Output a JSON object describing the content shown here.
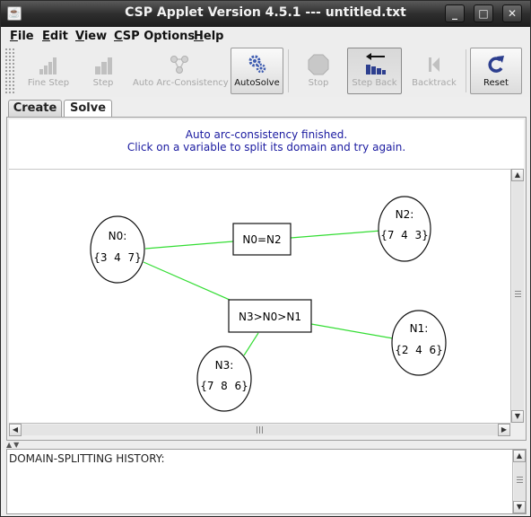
{
  "window": {
    "title": "CSP Applet Version 4.5.1 --- untitled.txt",
    "controls": {
      "minimize": "_",
      "maximize": "□",
      "close": "✕"
    }
  },
  "menu": {
    "items": [
      {
        "first": "F",
        "rest": "ile"
      },
      {
        "first": "E",
        "rest": "dit"
      },
      {
        "first": "V",
        "rest": "iew"
      },
      {
        "first": "C",
        "rest": "SP Options"
      },
      {
        "first": "H",
        "rest": "elp"
      }
    ]
  },
  "toolbar": {
    "buttons": [
      {
        "label": "Fine Step",
        "icon": "fine-step-icon",
        "enabled": false
      },
      {
        "label": "Step",
        "icon": "step-icon",
        "enabled": false
      },
      {
        "label": "Auto Arc-Consistency",
        "icon": "auto-arc-consistency-icon",
        "enabled": false
      },
      {
        "label": "AutoSolve",
        "icon": "autosolve-icon",
        "enabled": true
      },
      {
        "label": "Stop",
        "icon": "stop-icon",
        "enabled": false
      },
      {
        "label": "Step Back",
        "icon": "step-back-icon",
        "enabled": true
      },
      {
        "label": "Backtrack",
        "icon": "backtrack-icon",
        "enabled": false
      },
      {
        "label": "Reset",
        "icon": "reset-icon",
        "enabled": true
      }
    ]
  },
  "tabs": [
    {
      "label": "Create",
      "active": false
    },
    {
      "label": "Solve",
      "active": true
    }
  ],
  "message": {
    "line1": "Auto arc-consistency finished.",
    "line2": "Click on a variable to split its domain and try again."
  },
  "graph": {
    "variables": [
      {
        "id": "n0",
        "name": "N0:",
        "domain": "{3  4  7}"
      },
      {
        "id": "n1",
        "name": "N1:",
        "domain": "{2  4  6}"
      },
      {
        "id": "n2",
        "name": "N2:",
        "domain": "{7  4  3}"
      },
      {
        "id": "n3",
        "name": "N3:",
        "domain": "{7  8  6}"
      }
    ],
    "constraints": [
      {
        "id": "c1",
        "label": "N0=N2"
      },
      {
        "id": "c2",
        "label": "N3>N0>N1"
      }
    ],
    "edge_color": "#33dd33"
  },
  "history": {
    "label": "DOMAIN-SPLITTING HISTORY:"
  }
}
